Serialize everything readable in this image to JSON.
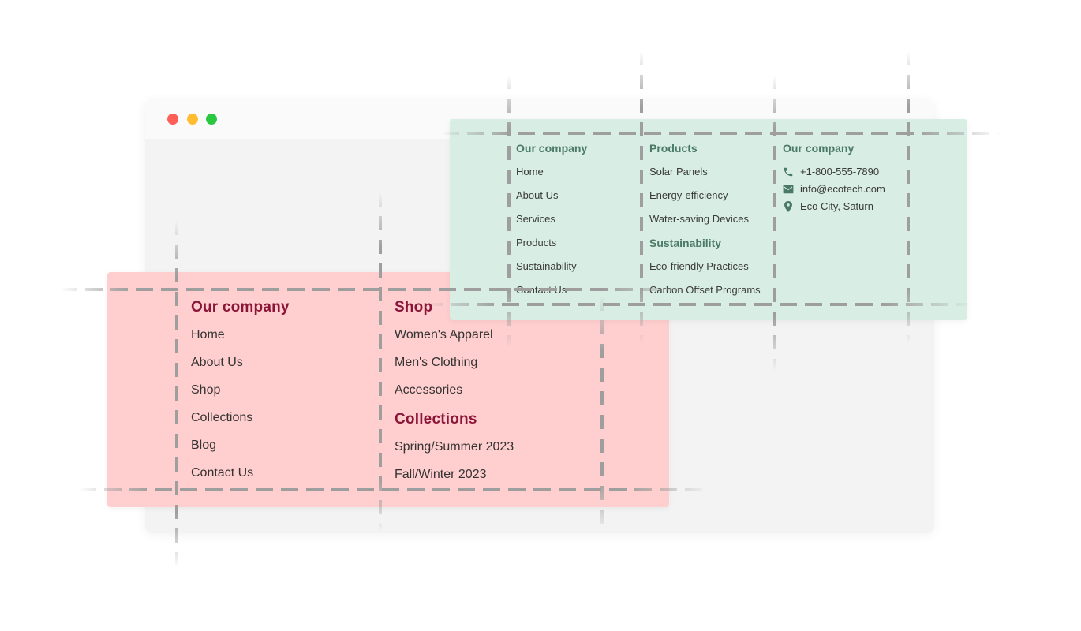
{
  "browser": {
    "window_controls": [
      {
        "name": "close",
        "color": "#ff5f57"
      },
      {
        "name": "minimize",
        "color": "#febc2e"
      },
      {
        "name": "maximize",
        "color": "#28c840"
      }
    ]
  },
  "colors": {
    "pink_panel": "#ffcece",
    "pink_heading": "#8a1538",
    "green_panel": "#d8ede4",
    "green_heading": "#4a7a65",
    "guide_line": "#9e9e9e"
  },
  "pink_footer": {
    "columns": [
      {
        "sections": [
          {
            "heading": "Our company",
            "links": [
              "Home",
              "About Us",
              "Shop",
              "Collections",
              "Blog",
              "Contact Us"
            ]
          }
        ]
      },
      {
        "sections": [
          {
            "heading": "Shop",
            "links": [
              "Women's Apparel",
              "Men's Clothing",
              "Accessories"
            ]
          },
          {
            "heading": "Collections",
            "links": [
              "Spring/Summer 2023",
              "Fall/Winter 2023"
            ]
          }
        ]
      }
    ]
  },
  "green_footer": {
    "columns": [
      {
        "sections": [
          {
            "heading": "Our company",
            "links": [
              "Home",
              "About Us",
              "Services",
              "Products",
              "Sustainability",
              "Contact Us"
            ]
          }
        ]
      },
      {
        "sections": [
          {
            "heading": "Products",
            "links": [
              "Solar Panels",
              "Energy-efficiency",
              "Water-saving Devices"
            ]
          },
          {
            "heading": "Sustainability",
            "links": [
              "Eco-friendly Practices",
              "Carbon Offset Programs"
            ]
          }
        ]
      },
      {
        "heading": "Our company",
        "contacts": [
          {
            "icon": "phone-icon",
            "text": "+1-800-555-7890"
          },
          {
            "icon": "mail-icon",
            "text": "info@ecotech.com"
          },
          {
            "icon": "location-pin-icon",
            "text": "Eco City, Saturn"
          }
        ]
      }
    ]
  }
}
